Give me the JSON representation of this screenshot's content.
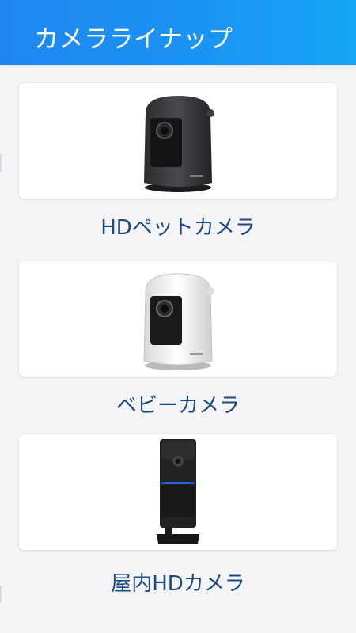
{
  "header": {
    "title": "カメラライナップ"
  },
  "products": [
    {
      "label": "HDペットカメラ",
      "image_icon": "pet-camera-black-icon",
      "body_color": "#3a3a3d"
    },
    {
      "label": "ベビーカメラ",
      "image_icon": "baby-camera-white-icon",
      "body_color": "#f1f1f1"
    },
    {
      "label": "屋内HDカメラ",
      "image_icon": "indoor-hd-camera-icon",
      "body_color": "#1e1e20"
    }
  ],
  "colors": {
    "header": "#1a95f3",
    "label": "#1d4a7e",
    "background": "#f4f4f6"
  }
}
